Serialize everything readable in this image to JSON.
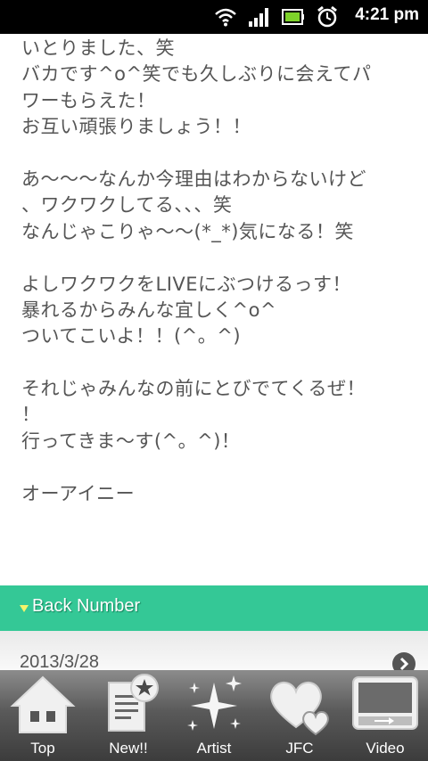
{
  "status_bar": {
    "time": "4:21 pm",
    "icons": [
      "wifi-icon",
      "signal-icon",
      "battery-icon",
      "alarm-icon"
    ]
  },
  "post": {
    "lines": [
      "いとりました、笑",
      "バカです^o^笑でも久しぶりに会えてパ",
      "ワーもらえた！",
      "お互い頑張りましょう！！",
      "",
      "あ～～～なんか今理由はわからないけど",
      "、ワクワクしてる、、、笑",
      "なんじゃこりゃ～～(*_*)気になる！笑",
      "",
      "よしワクワクをLIVEにぶつけるっす！",
      "暴れるからみんな宜しく^o^",
      "ついてこいよ！！(^。^)",
      "",
      "それじゃみんなの前にとびでてくるぜ！",
      "！",
      "行ってきま～す(^。^)！",
      "",
      "オーアイニー"
    ]
  },
  "back_number": {
    "label": "Back Number",
    "items": [
      {
        "date": "2013/3/28"
      }
    ]
  },
  "tab_bar": {
    "tabs": [
      {
        "label": "Top",
        "icon": "home-icon"
      },
      {
        "label": "New!!",
        "icon": "document-star-icon"
      },
      {
        "label": "Artist",
        "icon": "sparkle-icon"
      },
      {
        "label": "JFC",
        "icon": "hearts-icon"
      },
      {
        "label": "Video",
        "icon": "video-player-icon"
      }
    ]
  },
  "colors": {
    "accent_green": "#34c896",
    "text_gray": "#555555",
    "triangle_yellow": "#f4f46a"
  }
}
